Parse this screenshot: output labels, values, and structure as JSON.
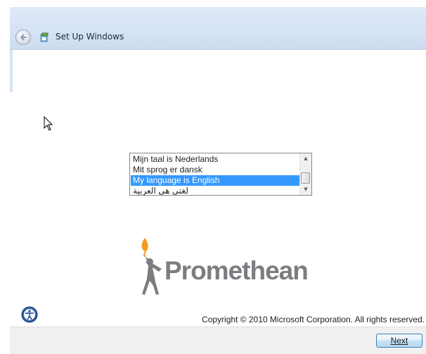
{
  "window": {
    "title": "Set Up Windows"
  },
  "language_list": {
    "items": [
      {
        "label": "Mijn taal is Nederlands",
        "selected": false
      },
      {
        "label": "Mit sprog er dansk",
        "selected": false
      },
      {
        "label": "My language is English",
        "selected": true
      },
      {
        "label": "لغتي هي العربية",
        "selected": false
      }
    ]
  },
  "logo": {
    "text": "Promethean",
    "flame_color": "#f29a1f",
    "figure_color": "#7b7d80"
  },
  "footer": {
    "copyright": "Copyright © 2010 Microsoft Corporation.  All rights reserved.",
    "next_label": "Next"
  },
  "icons": {
    "back": "back-arrow-icon",
    "setup": "setup-windows-icon",
    "accessibility": "ease-of-access-icon",
    "cursor": "mouse-pointer-icon"
  },
  "colors": {
    "selection": "#3399ff",
    "title_bar": "#d4e2f4",
    "button_border": "#3c7fb1"
  }
}
